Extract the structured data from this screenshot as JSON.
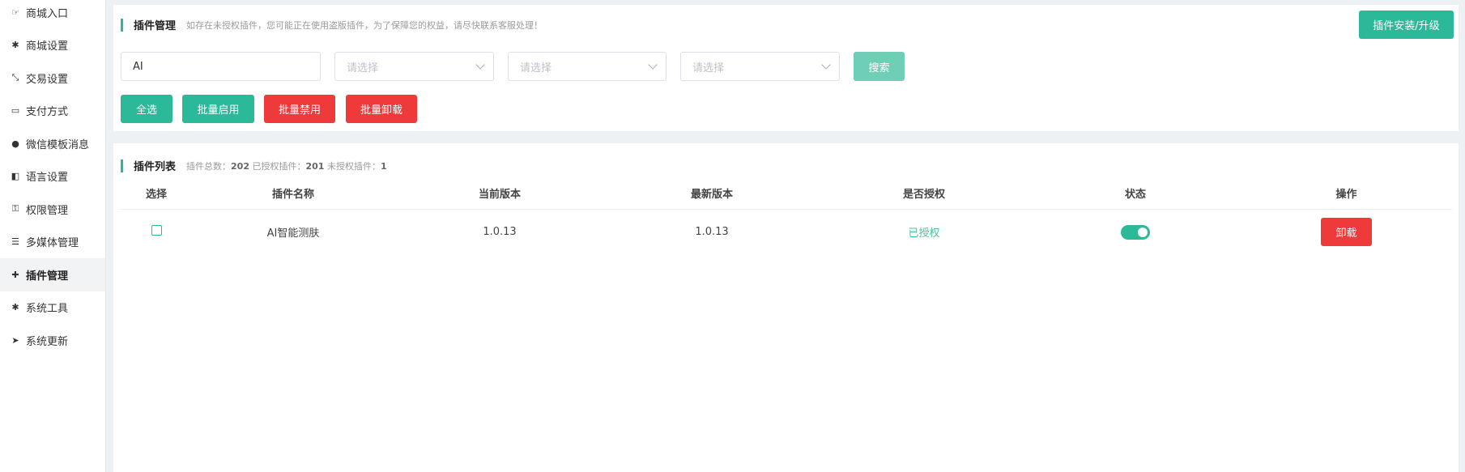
{
  "sidebar": {
    "items": [
      {
        "label": "商城入口",
        "icon": "hand-point-icon"
      },
      {
        "label": "商城设置",
        "icon": "gear-icon"
      },
      {
        "label": "交易设置",
        "icon": "transfer-icon"
      },
      {
        "label": "支付方式",
        "icon": "credit-card-icon"
      },
      {
        "label": "微信模板消息",
        "icon": "wechat-icon"
      },
      {
        "label": "语言设置",
        "icon": "language-icon"
      },
      {
        "label": "权限管理",
        "icon": "key-icon"
      },
      {
        "label": "多媒体管理",
        "icon": "list-icon"
      },
      {
        "label": "插件管理",
        "icon": "puzzle-icon",
        "active": true
      },
      {
        "label": "系统工具",
        "icon": "gear-icon"
      },
      {
        "label": "系统更新",
        "icon": "paper-plane-icon"
      }
    ]
  },
  "plugin_mgmt": {
    "title": "插件管理",
    "tip": "如存在未授权插件，您可能正在使用盗版插件，为了保障您的权益，请尽快联系客服处理！",
    "install_button": "插件安装/升级"
  },
  "filters": {
    "keyword_value": "AI",
    "select1_placeholder": "请选择",
    "select2_placeholder": "请选择",
    "select3_placeholder": "请选择",
    "search_button": "搜索"
  },
  "bulk_actions": {
    "select_all": "全选",
    "batch_enable": "批量启用",
    "batch_disable": "批量禁用",
    "batch_uninstall": "批量卸载"
  },
  "plugin_list": {
    "title": "插件列表",
    "summary_prefix_total": "插件总数：",
    "total": "202",
    "summary_prefix_authorized": "已授权插件：",
    "authorized": "201",
    "summary_prefix_unauthorized": "未授权插件：",
    "unauthorized": "1"
  },
  "table": {
    "headers": [
      "选择",
      "插件名称",
      "当前版本",
      "最新版本",
      "是否授权",
      "状态",
      "操作"
    ],
    "rows": [
      {
        "name": "AI智能测肤",
        "current_version": "1.0.13",
        "latest_version": "1.0.13",
        "auth_status": "已授权",
        "enabled": true,
        "action": "卸载"
      }
    ]
  },
  "colors": {
    "accent": "#2bb99a",
    "danger": "#ee3a3a"
  }
}
